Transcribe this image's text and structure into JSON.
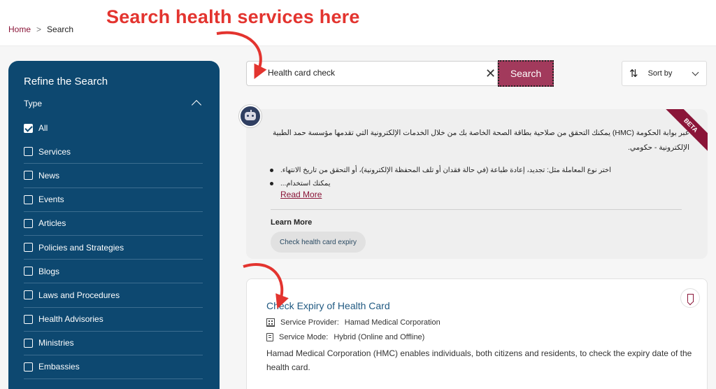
{
  "annotation": {
    "title": "Search health services here"
  },
  "breadcrumb": {
    "home": "Home",
    "separator": ">",
    "current": "Search"
  },
  "sidebar": {
    "title": "Refine the Search",
    "type_label": "Type",
    "items": [
      {
        "label": "All",
        "checked": true
      },
      {
        "label": "Services",
        "checked": false
      },
      {
        "label": "News",
        "checked": false
      },
      {
        "label": "Events",
        "checked": false
      },
      {
        "label": "Articles",
        "checked": false
      },
      {
        "label": "Policies and Strategies",
        "checked": false
      },
      {
        "label": "Blogs",
        "checked": false
      },
      {
        "label": "Laws and Procedures",
        "checked": false
      },
      {
        "label": "Health Advisories",
        "checked": false
      },
      {
        "label": "Ministries",
        "checked": false
      },
      {
        "label": "Embassies",
        "checked": false
      }
    ]
  },
  "search": {
    "value": "Health card check",
    "clear_glyph": "✕",
    "button_label": "Search"
  },
  "sort": {
    "label": "Sort by"
  },
  "ai_answer": {
    "badge": "BETA",
    "paragraph": "عبر بوابة الحكومة (HMC) يمكنك التحقق من صلاحية بطاقة الصحة الخاصة بك من خلال الخدمات الإلكترونية التي تقدمها مؤسسة حمد الطبية الإلكترونية - حكومي.",
    "bullets": [
      "اختر نوع المعاملة مثل: تجديد، إعادة طباعة (في حالة فقدان أو تلف المحفظة الإلكترونية)، أو التحقق من تاريخ الانتهاء.",
      "يمكنك استخدام..."
    ],
    "read_more": "Read More",
    "learn_more": "Learn More",
    "chip": "Check health card expiry"
  },
  "result": {
    "title": "Check Expiry of Health Card",
    "provider_label": "Service Provider:",
    "provider": "Hamad Medical Corporation",
    "mode_label": "Service Mode:",
    "mode": "Hybrid (Online and Offline)",
    "description": "Hamad Medical Corporation (HMC) enables individuals, both citizens and residents, to check the expiry date of the health card."
  },
  "colors": {
    "sidebar_bg": "#0d4870",
    "accent": "#8a1538",
    "search_button": "#a23a5c",
    "annotation_red": "#e3342f",
    "link_blue": "#215a82"
  }
}
